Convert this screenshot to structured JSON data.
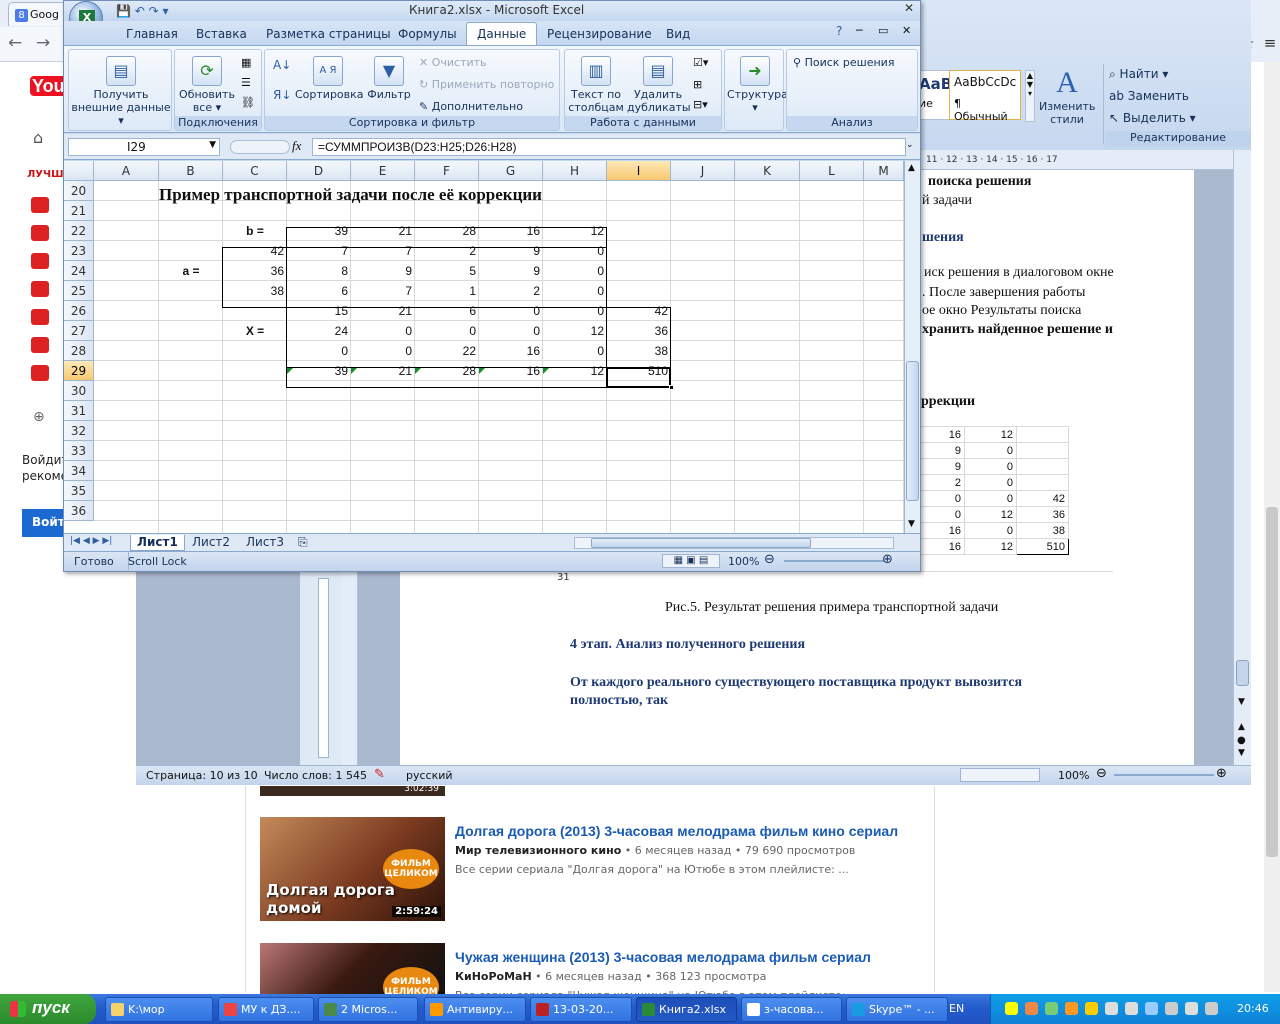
{
  "chrome": {
    "tab_title": "Goog",
    "back_icon": "back-arrow-icon",
    "forward_icon": "forward-arrow-icon"
  },
  "youtube": {
    "logo": "You",
    "best_label": "ЛУЧШ",
    "login_text": "Войдит увидет рекоме",
    "login_button": "Войти",
    "videos": [
      {
        "title": "Долгая дорога (2013) 3-часовая мелодрама фильм кино сериал",
        "channel": "Мир телевизионного кино",
        "meta": "• 6 месяцев назад • 79 690 просмотров",
        "desc": "Все серии сериала \"Долгая дорога\" на Ютюбе в этом плейлисте: ...",
        "duration": "2:59:24",
        "thumb_caption": "Долгая дорога домой",
        "thumb_badge": "ФИЛЬМ ЦЕЛИКОМ"
      },
      {
        "title": "Чужая женщина (2013) 3-часовая мелодрама фильм сериал",
        "channel": "КиНоРоМаН",
        "meta": "• 6 месяцев назад • 368 123 просмотра",
        "desc": "Все серии сериала \"Чужая женщина\" на Ютюбе в этом плейлисте: ...",
        "duration": "",
        "thumb_caption": "",
        "thumb_badge": "ФИЛЬМ ЦЕЛИКОМ"
      }
    ],
    "prev_duration": "3:02:39"
  },
  "word": {
    "ribbon": {
      "style1": "АаВbСс",
      "style1_sub": "ие",
      "style2": "AaBbCcDc",
      "style2_sub": "¶ Обычный",
      "change_styles": "Изменить стили",
      "find": "Найти",
      "replace": "Заменить",
      "select": "Выделить",
      "group_edit": "Редактирование"
    },
    "ruler": "11 · 12 · 13 · 14 · 15 · 16 · 17",
    "lines": [
      "поиска решения",
      "й задачи",
      "шения",
      "иск решения в диалоговом окне",
      ".  После  завершения  работы",
      "ое  окно  Результаты  поиска",
      "хранить найденное решение и",
      "оррекции"
    ],
    "table_rows": [
      [
        "16",
        "12",
        ""
      ],
      [
        "9",
        "0",
        ""
      ],
      [
        "9",
        "0",
        ""
      ],
      [
        "2",
        "0",
        ""
      ],
      [
        "0",
        "0",
        "42"
      ],
      [
        "0",
        "12",
        "36"
      ],
      [
        "16",
        "0",
        "38"
      ],
      [
        "16",
        "12",
        "510"
      ]
    ],
    "row31": "31",
    "figure_caption": "Рис.5. Результат решения примера транспортной задачи",
    "stage_heading": "4 этап. Анализ полученного решения",
    "paragraph_line1": "От  каждого  реального  существующего  поставщика  продукт  вывозится",
    "paragraph_line2": "полностью, так",
    "status": {
      "page": "Страница: 10 из 10",
      "words": "Число слов: 1 545",
      "lang": "русский",
      "zoom": "100%"
    }
  },
  "excel": {
    "title": "Книга2.xlsx - Microsoft Excel",
    "tabs": [
      "Главная",
      "Вставка",
      "Разметка страницы",
      "Формулы",
      "Данные",
      "Рецензирование",
      "Вид"
    ],
    "active_tab": "Данные",
    "ribbon": {
      "get_external": "Получить внешние данные",
      "refresh_all": "Обновить все",
      "sort_az": "А Я",
      "sort": "Сортировка",
      "filter": "Фильтр",
      "clear": "Очистить",
      "reapply": "Применить повторно",
      "advanced": "Дополнительно",
      "text_to_cols": "Текст по столбцам",
      "remove_dups": "Удалить дубликаты",
      "outline": "Структура",
      "solver": "Поиск решения",
      "grp_connections": "Подключения",
      "grp_sortfilter": "Сортировка и фильтр",
      "grp_datatools": "Работа с данными",
      "grp_analysis": "Анализ"
    },
    "name_box": "I29",
    "fx": "fx",
    "formula": "=СУММПРОИЗВ(D23:H25;D26:H28)",
    "columns": [
      "A",
      "B",
      "C",
      "D",
      "E",
      "F",
      "G",
      "H",
      "I",
      "J",
      "K",
      "L",
      "M"
    ],
    "rows": [
      "20",
      "21",
      "22",
      "23",
      "24",
      "25",
      "26",
      "27",
      "28",
      "29",
      "30",
      "31",
      "32",
      "33",
      "34",
      "35",
      "36"
    ],
    "sheet_title": "Пример транспортной задачи после её коррекции",
    "labels": {
      "b": "b =",
      "a": "a =",
      "x": "X ="
    },
    "b_row": [
      "39",
      "21",
      "28",
      "16",
      "12"
    ],
    "a_col": [
      "42",
      "36",
      "38"
    ],
    "cost": [
      [
        "7",
        "7",
        "2",
        "9",
        "0"
      ],
      [
        "8",
        "9",
        "5",
        "9",
        "0"
      ],
      [
        "6",
        "7",
        "1",
        "2",
        "0"
      ]
    ],
    "x_rows": [
      [
        "15",
        "21",
        "6",
        "0",
        "0",
        "42"
      ],
      [
        "24",
        "0",
        "0",
        "0",
        "12",
        "36"
      ],
      [
        "0",
        "0",
        "22",
        "16",
        "0",
        "38"
      ]
    ],
    "sum_row": [
      "39",
      "21",
      "28",
      "16",
      "12",
      "510"
    ],
    "sheets": [
      "Лист1",
      "Лист2",
      "Лист3"
    ],
    "status": {
      "ready": "Готово",
      "scroll_lock": "Scroll Lock",
      "zoom": "100%"
    }
  },
  "taskbar": {
    "start": "пуск",
    "buttons": [
      "K:\\мор",
      "МУ к ДЗ....",
      "2 Micros...",
      "Антивиру...",
      "13-03-20...",
      "Книга2.xlsx",
      "з-часова...",
      "Skype™ - ..."
    ],
    "active": "Книга2.xlsx",
    "lang": "EN",
    "time": "20:46"
  }
}
